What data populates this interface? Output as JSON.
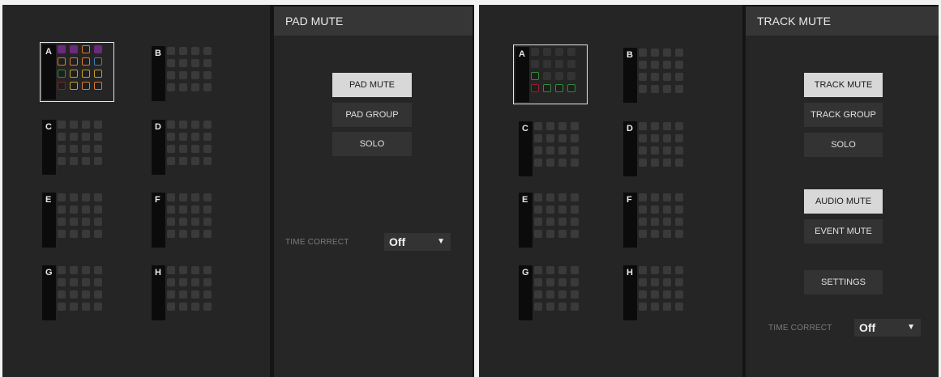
{
  "left": {
    "header": "PAD MUTE",
    "banks": [
      {
        "letter": "A",
        "selected": true,
        "pads": [
          [
            "#6b2a7c",
            "#6b2a7c",
            "#e07a2c",
            "#6b2a7c"
          ],
          [
            "#e07a2c",
            "#e07a2c",
            "#e07a2c",
            "#3d7fb8"
          ],
          [
            "#2f8a3a",
            "#c8a02a",
            "#c8a02a",
            "#c8a02a"
          ],
          [
            "#8a1f2a",
            "#c8a02a",
            "#e07a2c",
            "#e07a2c"
          ]
        ]
      },
      {
        "letter": "B",
        "selected": false
      },
      {
        "letter": "C",
        "selected": false
      },
      {
        "letter": "D",
        "selected": false
      },
      {
        "letter": "E",
        "selected": false
      },
      {
        "letter": "F",
        "selected": false
      },
      {
        "letter": "G",
        "selected": false
      },
      {
        "letter": "H",
        "selected": false
      }
    ],
    "buttons": {
      "pad_mute": "PAD MUTE",
      "pad_group": "PAD GROUP",
      "solo": "SOLO"
    },
    "time_correct": {
      "label": "TIME CORRECT",
      "value": "Off"
    }
  },
  "right": {
    "header": "TRACK MUTE",
    "banks": [
      {
        "letter": "A",
        "selected": true,
        "pads": [
          [
            null,
            null,
            null,
            null
          ],
          [
            null,
            null,
            null,
            null
          ],
          [
            "#2f8a3a",
            null,
            null,
            null
          ],
          [
            "#9a1f2a",
            "#2f8a3a",
            "#2f8a3a",
            "#2f8a3a"
          ]
        ]
      },
      {
        "letter": "B",
        "selected": false
      },
      {
        "letter": "C",
        "selected": false
      },
      {
        "letter": "D",
        "selected": false
      },
      {
        "letter": "E",
        "selected": false
      },
      {
        "letter": "F",
        "selected": false
      },
      {
        "letter": "G",
        "selected": false
      },
      {
        "letter": "H",
        "selected": false
      }
    ],
    "buttons": {
      "track_mute": "TRACK MUTE",
      "track_group": "TRACK GROUP",
      "solo": "SOLO",
      "audio_mute": "AUDIO MUTE",
      "event_mute": "EVENT MUTE",
      "settings": "SETTINGS"
    },
    "time_correct": {
      "label": "TIME CORRECT",
      "value": "Off"
    }
  }
}
